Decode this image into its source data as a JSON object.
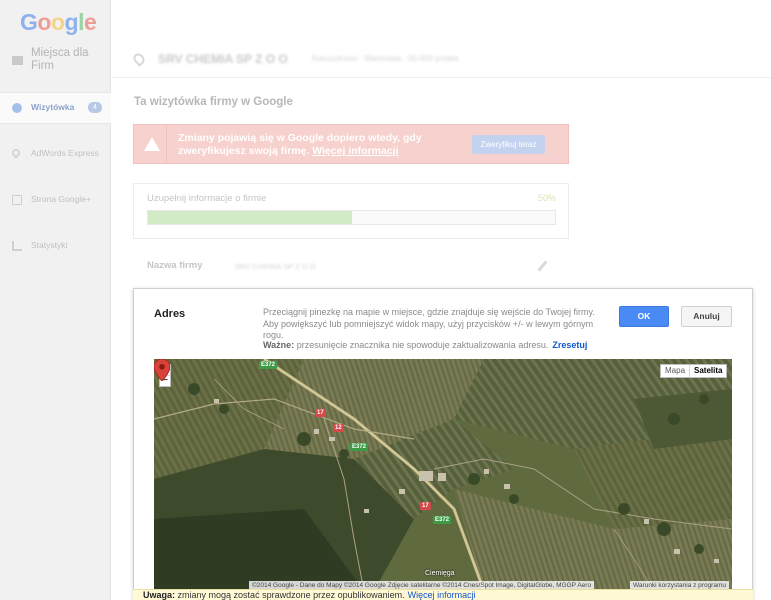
{
  "app": {
    "logo_letters": [
      "G",
      "o",
      "o",
      "g",
      "l",
      "e"
    ],
    "product": "Miejsca dla Firm"
  },
  "sidebar": {
    "items": [
      {
        "label": "Wizytówka",
        "badge": "4",
        "icon": "info-icon",
        "active": true
      },
      {
        "label": "AdWords Express",
        "icon": "pin-icon",
        "active": false
      },
      {
        "label": "Strona Google+",
        "icon": "google-plus-icon",
        "active": false
      },
      {
        "label": "Statystyki",
        "icon": "stats-icon",
        "active": false
      }
    ]
  },
  "topbar": {
    "business_name": "SRV CHEMIA SP Z O O",
    "address": "Kocuczkowo · Warszawa · 00-000 polska"
  },
  "page": {
    "heading": "Ta wizytówka firmy w Google",
    "warning": {
      "text": "Zmiany pojawią się w Google dopiero wtedy, gdy zweryfikujesz swoją firmę.",
      "link": "Więcej informacji",
      "button": "Zweryfikuj teraz"
    },
    "progress": {
      "label": "Uzupełnij informacje o firmie",
      "percent_text": "50%",
      "fraction": 0.5
    },
    "name_field": {
      "label": "Nazwa firmy",
      "value": "SRV CHEMIA SP Z O O"
    }
  },
  "dialog": {
    "title": "Adres",
    "instruction": "Przeciągnij pinezkę na mapie w miejsce, gdzie znajduje się wejście do Twojej firmy. Aby powiększyć lub pomniejszyć widok mapy, użyj przycisków +/- w lewym górnym rogu.",
    "note_label": "Ważne:",
    "note_text": "przesunięcie znacznika nie spowoduje zaktualizowania adresu.",
    "reset_link": "Zresetuj",
    "ok_button": "OK",
    "cancel_button": "Anuluj",
    "map": {
      "zoom_in": "+",
      "zoom_out": "−",
      "type_map": "Mapa",
      "type_satellite": "Satelita",
      "credit": "©2014 Google - Dane do Mapy ©2014 Google Zdjęcie satelitarne ©2014 Cnes/Spot Image, DigitalGlobe, MGGP Aero",
      "terms": "Warunki korzystania z programu",
      "place_label": "Ciemięga",
      "road_labels": [
        "E372",
        "17",
        "12",
        "E372",
        "17",
        "E372"
      ]
    }
  },
  "footer": {
    "label": "Uwaga:",
    "text": "zmiany mogą zostać sprawdzone przez opublikowaniem.",
    "link": "Więcej informacji"
  },
  "colors": {
    "ok_button": "#4a8af4",
    "link": "#1155cc",
    "warning_bg": "#f6d1cd",
    "marker": "#d8423a"
  }
}
